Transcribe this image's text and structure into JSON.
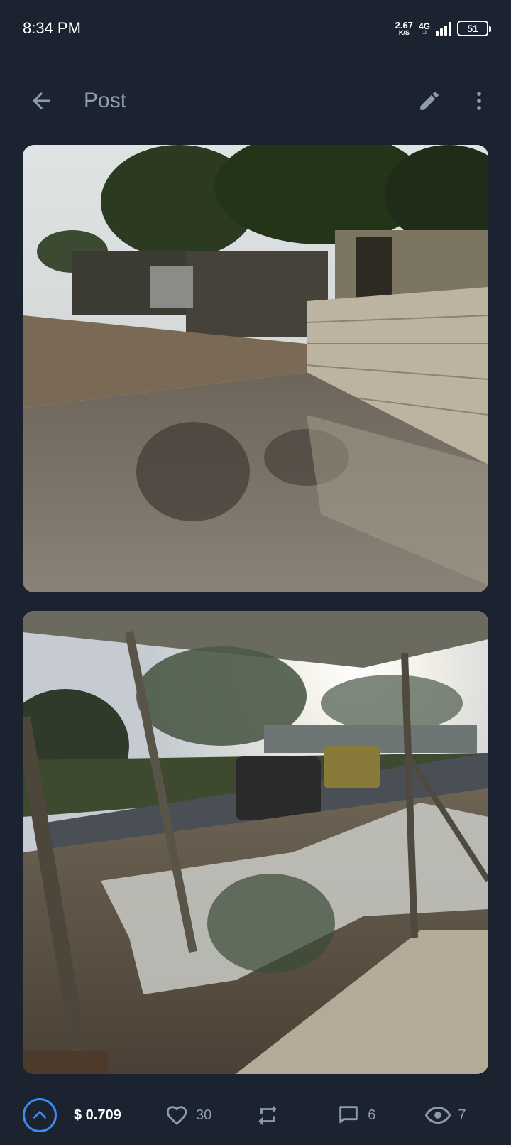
{
  "status_bar": {
    "time": "8:34 PM",
    "net_speed": "2.67",
    "net_speed_unit": "K/S",
    "net_type": "4G",
    "net_type_sub": "1l",
    "battery": "51"
  },
  "header": {
    "title": "Post",
    "icons": [
      "arrow-left-icon",
      "pencil-icon",
      "more-vertical-icon"
    ]
  },
  "photos": [
    {
      "name": "post-photo-1",
      "description_icon": "image"
    },
    {
      "name": "post-photo-2",
      "description_icon": "image"
    }
  ],
  "actions": {
    "payout": "$ 0.709",
    "likes": "30",
    "comments": "6",
    "views": "7"
  },
  "colors": {
    "background": "#1b2331",
    "accent": "#3d8bf2",
    "muted": "#8f9bad"
  }
}
